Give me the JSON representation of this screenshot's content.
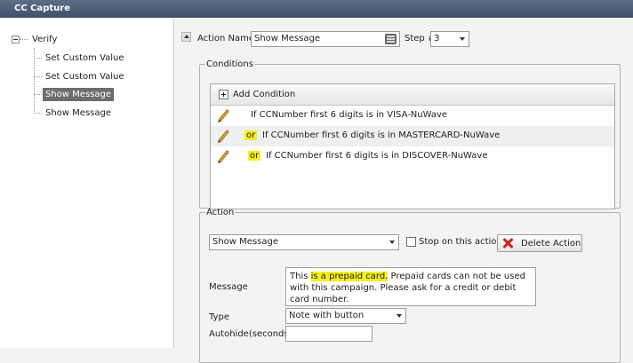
{
  "window": {
    "title": "CC Capture"
  },
  "tree": {
    "root": "Verify",
    "items": [
      {
        "label": "Set Custom Value"
      },
      {
        "label": "Set Custom Value"
      },
      {
        "label": "Show Message"
      },
      {
        "label": "Show Message"
      }
    ]
  },
  "header": {
    "action_name_label": "Action Name",
    "action_name_value": "Show Message",
    "step_label": "Step #",
    "step_value": "3"
  },
  "conditions": {
    "legend": "Conditions",
    "add_label": "Add Condition",
    "rows": [
      {
        "prefix": "",
        "text": "If CCNumber first 6 digits is in VISA-NuWave"
      },
      {
        "prefix": "or",
        "text": "If CCNumber first 6 digits is in MASTERCARD-NuWave"
      },
      {
        "prefix": "or",
        "text": "If CCNumber first 6 digits is in DISCOVER-NuWave"
      }
    ]
  },
  "action": {
    "legend": "Action",
    "type_value": "Show Message",
    "stop_label": "Stop on this action",
    "stop_checked": false,
    "delete_label": "Delete Action",
    "message_label": "Message",
    "message_before": "This ",
    "message_highlight": "is a prepaid card.",
    "message_after": " Prepaid cards can not be used with this campaign. Please ask for a credit or debit card number.",
    "type_label": "Type",
    "type_select_value": "Note with button",
    "autohide_label": "Autohide(seconds)",
    "autohide_value": ""
  },
  "colors": {
    "highlight": "#f5ee1c",
    "titlebar": "#4a5c74",
    "selection": "#6d6d6d",
    "delete_icon": "#d0201c"
  }
}
